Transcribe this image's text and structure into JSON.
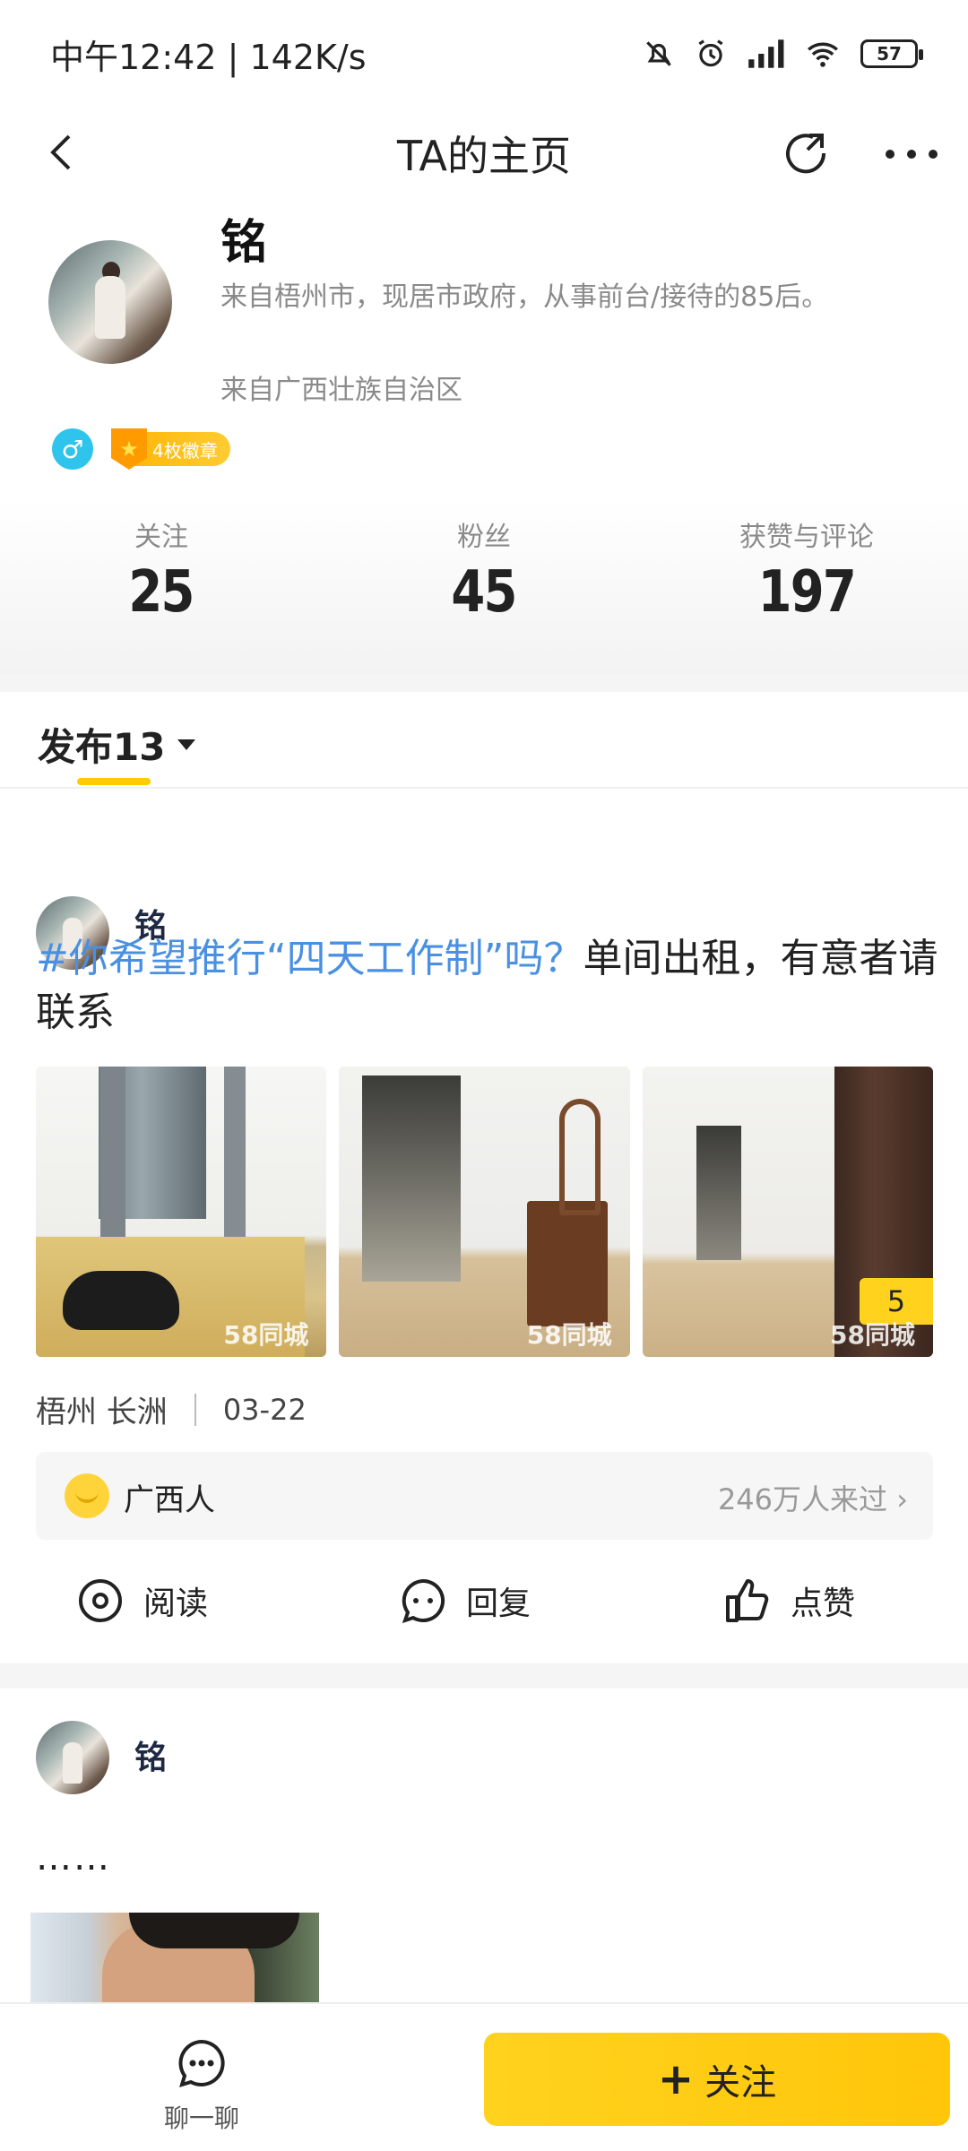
{
  "status_bar": {
    "time": "中午12:42 | 142K/s",
    "battery": "57"
  },
  "nav": {
    "title": "TA的主页"
  },
  "profile": {
    "name": "铭",
    "bio": "来自梧州市，现居市政府，从事前台/接待的85后。",
    "region": "来自广西壮族自治区",
    "gender_symbol": "♂",
    "badge": "4枚徽章"
  },
  "stats": [
    {
      "label": "关注",
      "value": "25"
    },
    {
      "label": "粉丝",
      "value": "45"
    },
    {
      "label": "获赞与评论",
      "value": "197"
    }
  ],
  "tab": {
    "label": "发布13"
  },
  "posts": [
    {
      "author": "铭",
      "topic": "#你希望推行“四天工作制”吗？",
      "text": "单间出租，有意者请联系",
      "watermark": "58同城",
      "image_count": "5",
      "location": "梧州 长洲",
      "date": "03-22",
      "circle_name": "广西人",
      "circle_visitors": "246万人来过",
      "actions": {
        "read": "阅读",
        "reply": "回复",
        "like": "点赞"
      }
    },
    {
      "author": "铭",
      "text": "……"
    }
  ],
  "bottom_bar": {
    "chat_label": "聊一聊",
    "follow_label": "关注"
  }
}
